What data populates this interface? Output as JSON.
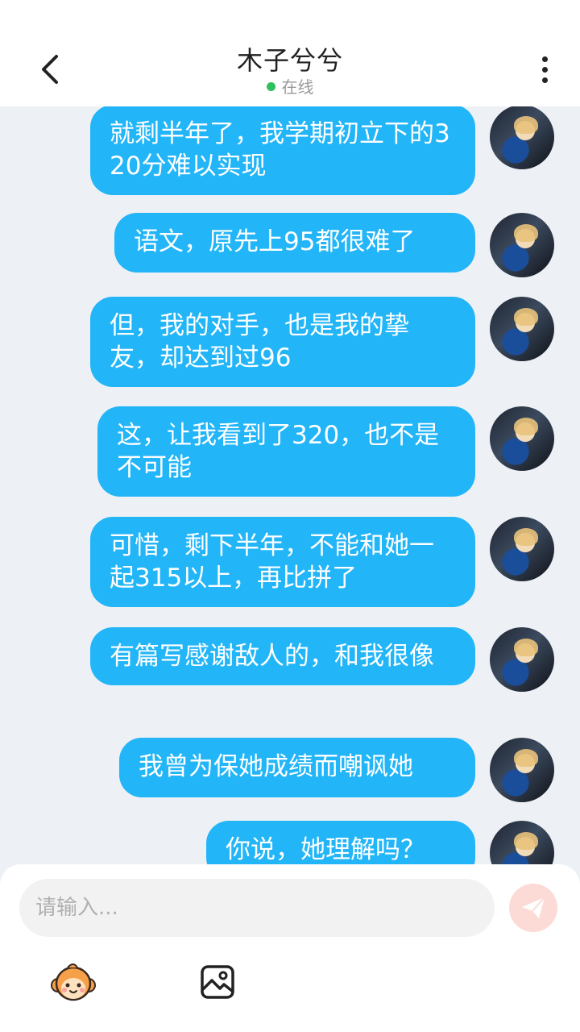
{
  "header": {
    "title": "木子兮兮",
    "status": "在线"
  },
  "messages": [
    {
      "text": "就剩半年了，我学期初立下的320分难以实现"
    },
    {
      "text": "语文，原先上95都很难了"
    },
    {
      "text": "但，我的对手，也是我的挚友，却达到过96"
    },
    {
      "text": "这，让我看到了320，也不是不可能"
    },
    {
      "text": "可惜，剩下半年，不能和她一起315以上，再比拼了"
    },
    {
      "text": "有篇写感谢敌人的，和我很像"
    },
    {
      "text": "我曾为保她成绩而嘲讽她"
    },
    {
      "text": "你说，她理解吗？"
    }
  ],
  "input": {
    "placeholder": "请输入..."
  },
  "colors": {
    "bubble": "#22b5f8",
    "online": "#2fc05e",
    "send": "#fcdad5"
  }
}
